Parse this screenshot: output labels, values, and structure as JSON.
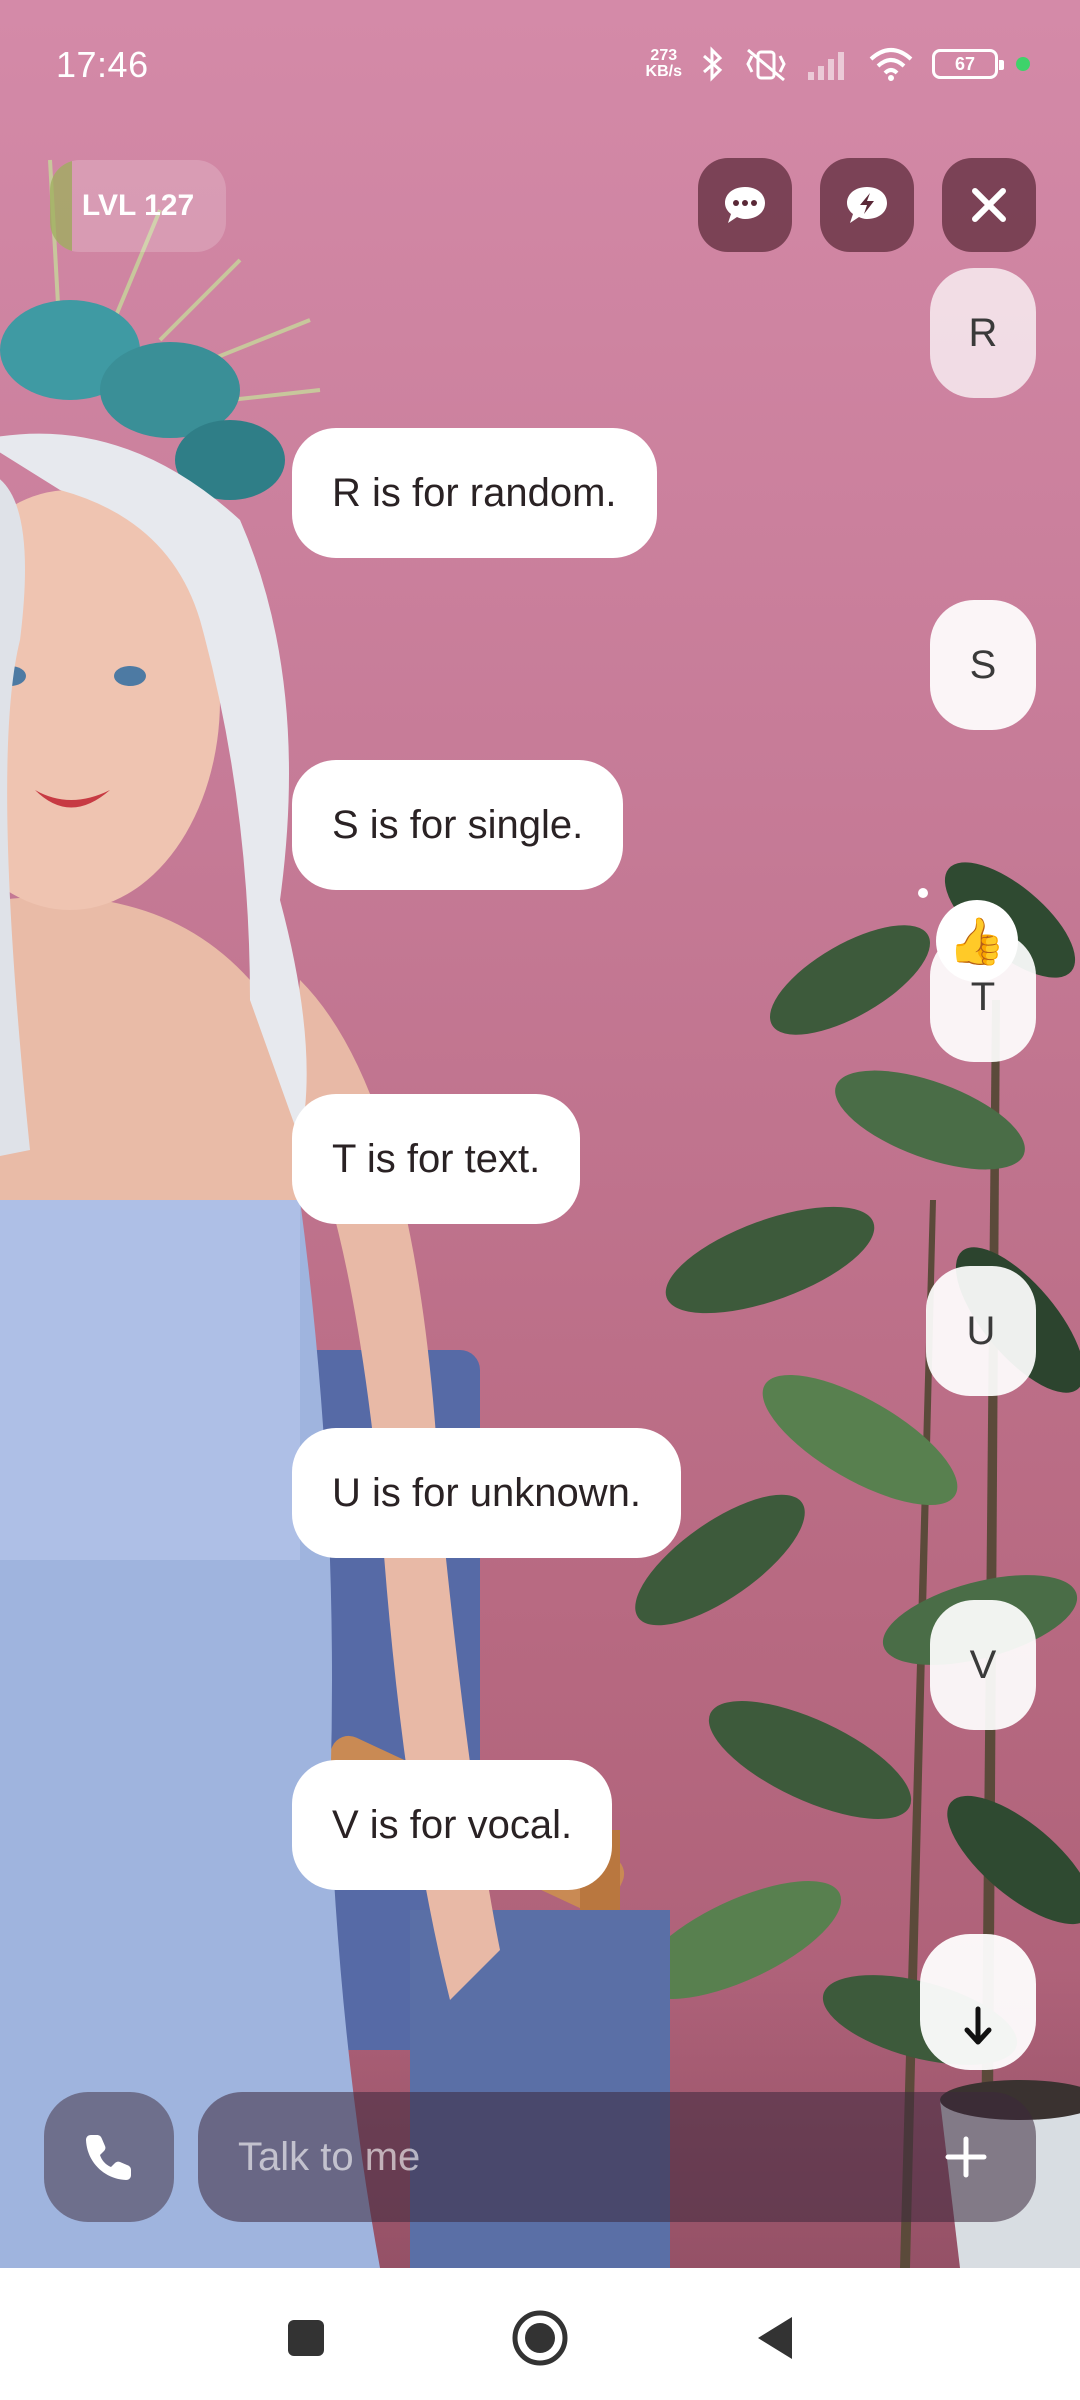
{
  "status_bar": {
    "time": "17:46",
    "net_speed_value": "273",
    "net_speed_unit": "KB/s",
    "battery": "67",
    "icons": [
      "bluetooth-icon",
      "mute-vibrate-icon",
      "signal-icon",
      "wifi-icon",
      "battery-icon",
      "charging-dot"
    ]
  },
  "header": {
    "level_label": "LVL 127",
    "buttons": [
      "chat-bubble-icon",
      "bolt-chat-icon",
      "close-icon"
    ]
  },
  "messages": [
    {
      "from": "user",
      "text": "R"
    },
    {
      "from": "bot",
      "text": "R is for random."
    },
    {
      "from": "user",
      "text": "S"
    },
    {
      "from": "bot",
      "text": "S is for single."
    },
    {
      "from": "user",
      "text": "T",
      "reaction": "👍"
    },
    {
      "from": "bot",
      "text": "T is for text."
    },
    {
      "from": "user",
      "text": "U"
    },
    {
      "from": "bot",
      "text": "U is for unknown."
    },
    {
      "from": "user",
      "text": "V"
    },
    {
      "from": "bot",
      "text": "V is for vocal."
    }
  ],
  "composer": {
    "placeholder": "Talk to me",
    "icons": [
      "phone-icon",
      "plus-icon",
      "arrow-down-icon"
    ]
  },
  "colors": {
    "background": "#c67b97",
    "button_dark": "#5a2837",
    "bubble": "#ffffff",
    "charge_dot": "#3ed36a"
  }
}
